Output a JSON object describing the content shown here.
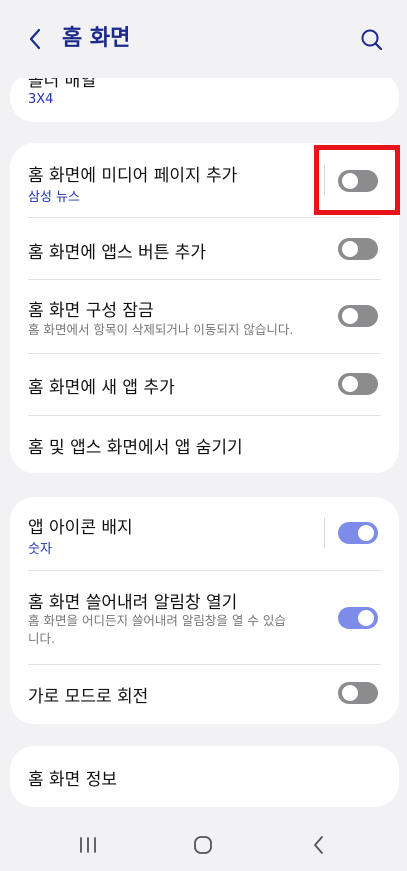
{
  "header": {
    "title": "홈 화면",
    "back_icon": "chevron-left-icon",
    "search_icon": "search-icon"
  },
  "card1": {
    "title": "폴더 배열",
    "value": "3X4"
  },
  "card2": {
    "rows": [
      {
        "title": "홈 화면에 미디어 페이지 추가",
        "subtitle": "삼성 뉴스",
        "toggle": "off"
      },
      {
        "title": "홈 화면에 앱스 버튼 추가",
        "toggle": "off"
      },
      {
        "title": "홈 화면 구성 잠금",
        "description": "홈 화면에서 항목이 삭제되거나 이동되지 않습니다.",
        "toggle": "off"
      },
      {
        "title": "홈 화면에 새 앱 추가",
        "toggle": "off"
      },
      {
        "title": "홈 및 앱스 화면에서 앱 숨기기"
      }
    ]
  },
  "card3": {
    "rows": [
      {
        "title": "앱 아이콘 배지",
        "subtitle": "숫자",
        "toggle": "on"
      },
      {
        "title": "홈 화면 쓸어내려 알림창 열기",
        "description": "홈 화면을 어디든지 쓸어내려 알림창을 열 수 있습니다.",
        "toggle": "on"
      },
      {
        "title": "가로 모드로 회전",
        "toggle": "off"
      }
    ]
  },
  "card4": {
    "title": "홈 화면 정보"
  },
  "colors": {
    "accent": "#1c2a8c",
    "link": "#1f35b5",
    "toggle_on": "#7d8ce8",
    "toggle_off": "#8c8c8e",
    "highlight": "#e8141c"
  },
  "navbar": {
    "icons": [
      "recent-apps-icon",
      "home-icon",
      "back-icon"
    ]
  }
}
